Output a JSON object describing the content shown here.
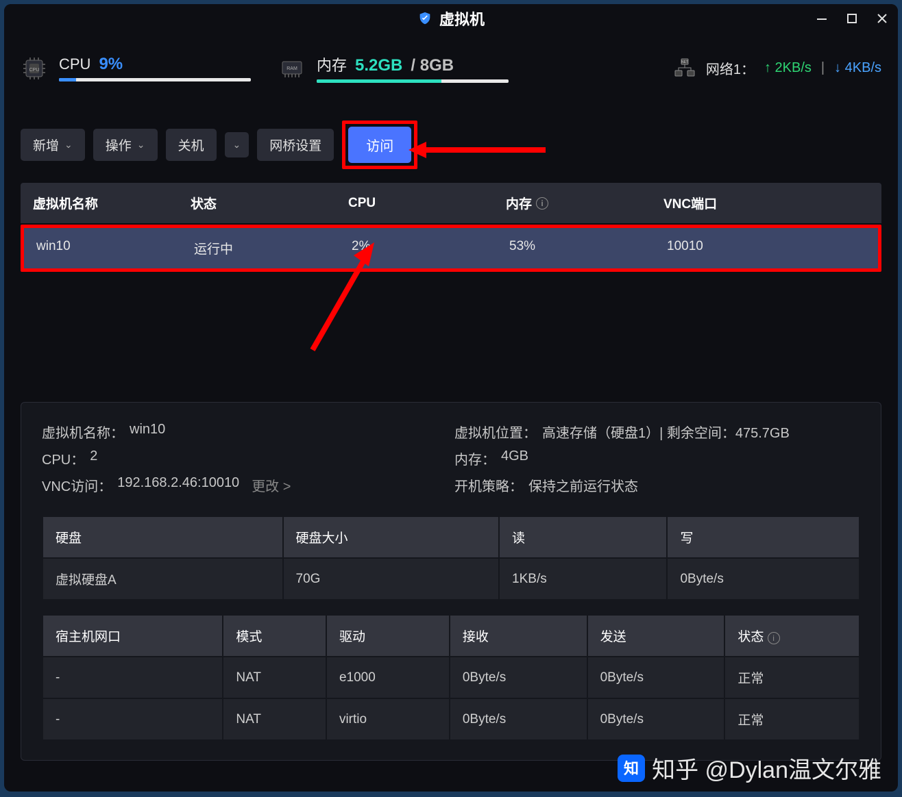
{
  "window": {
    "title": "虚拟机"
  },
  "stats": {
    "cpu": {
      "label": "CPU",
      "value": "9%",
      "bar_pct": 9
    },
    "mem": {
      "label": "内存",
      "used": "5.2GB",
      "total": "8GB",
      "bar_pct": 65
    },
    "net": {
      "label": "网络1：",
      "up": "2KB/s",
      "down": "4KB/s"
    }
  },
  "toolbar": {
    "add": "新增",
    "ops": "操作",
    "shutdown": "关机",
    "bridge": "网桥设置",
    "access": "访问"
  },
  "vm_table": {
    "headers": {
      "name": "虚拟机名称",
      "status": "状态",
      "cpu": "CPU",
      "mem": "内存",
      "vnc": "VNC端口"
    },
    "row": {
      "name": "win10",
      "status": "运行中",
      "cpu": "2%",
      "mem": "53%",
      "vnc": "10010"
    }
  },
  "details": {
    "name_label": "虚拟机名称：",
    "name_value": "win10",
    "cpu_label": "CPU：",
    "cpu_value": "2",
    "vnc_label": "VNC访问：",
    "vnc_value": "192.168.2.46:10010",
    "change": "更改 >",
    "location_label": "虚拟机位置：",
    "location_value": "高速存储（硬盘1）| 剩余空间：475.7GB",
    "mem_label": "内存：",
    "mem_value": "4GB",
    "boot_label": "开机策略：",
    "boot_value": "保持之前运行状态"
  },
  "disk_table": {
    "headers": {
      "disk": "硬盘",
      "size": "硬盘大小",
      "read": "读",
      "write": "写"
    },
    "row": {
      "disk": "虚拟硬盘A",
      "size": "70G",
      "read": "1KB/s",
      "write": "0Byte/s"
    }
  },
  "net_table": {
    "headers": {
      "host": "宿主机网口",
      "mode": "模式",
      "driver": "驱动",
      "rx": "接收",
      "tx": "发送",
      "status": "状态"
    },
    "rows": [
      {
        "host": "-",
        "mode": "NAT",
        "driver": "e1000",
        "rx": "0Byte/s",
        "tx": "0Byte/s",
        "status": "正常"
      },
      {
        "host": "-",
        "mode": "NAT",
        "driver": "virtio",
        "rx": "0Byte/s",
        "tx": "0Byte/s",
        "status": "正常"
      }
    ]
  },
  "watermark": "知乎 @Dylan温文尔雅"
}
